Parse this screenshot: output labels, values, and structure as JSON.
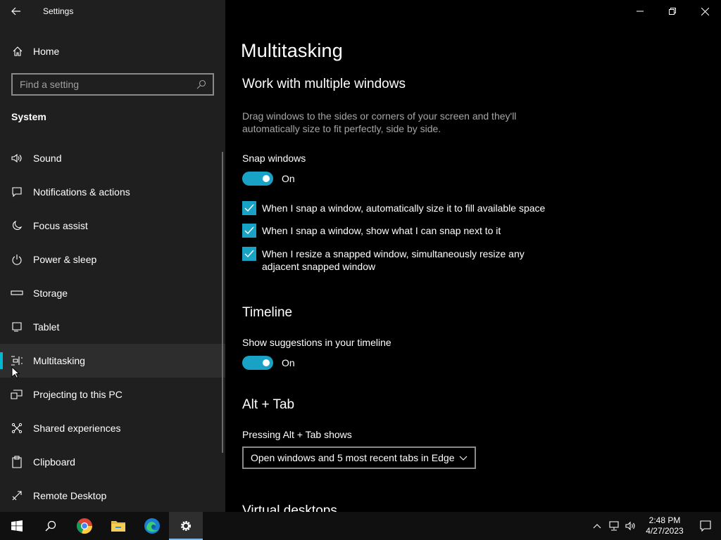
{
  "app": {
    "title": "Settings"
  },
  "sidebar": {
    "home_label": "Home",
    "search_placeholder": "Find a setting",
    "section": "System",
    "items": [
      {
        "label": "Sound",
        "icon": "speaker-icon"
      },
      {
        "label": "Notifications & actions",
        "icon": "notification-icon"
      },
      {
        "label": "Focus assist",
        "icon": "moon-icon"
      },
      {
        "label": "Power & sleep",
        "icon": "power-icon"
      },
      {
        "label": "Storage",
        "icon": "storage-icon"
      },
      {
        "label": "Tablet",
        "icon": "tablet-icon"
      },
      {
        "label": "Multitasking",
        "icon": "multitasking-icon",
        "active": true
      },
      {
        "label": "Projecting to this PC",
        "icon": "projecting-icon"
      },
      {
        "label": "Shared experiences",
        "icon": "shared-experiences-icon"
      },
      {
        "label": "Clipboard",
        "icon": "clipboard-icon"
      },
      {
        "label": "Remote Desktop",
        "icon": "remote-desktop-icon"
      }
    ]
  },
  "main": {
    "page_title": "Multitasking",
    "snap": {
      "heading": "Work with multiple windows",
      "description": "Drag windows to the sides or corners of your screen and they'll automatically size to fit perfectly, side by side.",
      "toggle_label": "Snap windows",
      "toggle_state": "On",
      "options": [
        {
          "label": "When I snap a window, automatically size it to fill available space",
          "checked": true
        },
        {
          "label": "When I snap a window, show what I can snap next to it",
          "checked": true
        },
        {
          "label": "When I resize a snapped window, simultaneously resize any adjacent snapped window",
          "checked": true
        }
      ]
    },
    "timeline": {
      "heading": "Timeline",
      "toggle_label": "Show suggestions in your timeline",
      "toggle_state": "On"
    },
    "alttab": {
      "heading": "Alt + Tab",
      "label": "Pressing Alt + Tab shows",
      "selected": "Open windows and 5 most recent tabs in Edge"
    },
    "virtual_desktops": {
      "heading": "Virtual desktops"
    }
  },
  "taskbar": {
    "apps": [
      "start-icon",
      "search-icon",
      "chrome-icon",
      "file-explorer-icon",
      "edge-icon",
      "settings-icon"
    ],
    "time": "2:48 PM",
    "date": "4/27/2023"
  },
  "colors": {
    "accent": "#18a3c6",
    "nav_accent": "#00b7d4",
    "sidebar_bg": "#1f1f1f",
    "main_bg": "#000000"
  }
}
